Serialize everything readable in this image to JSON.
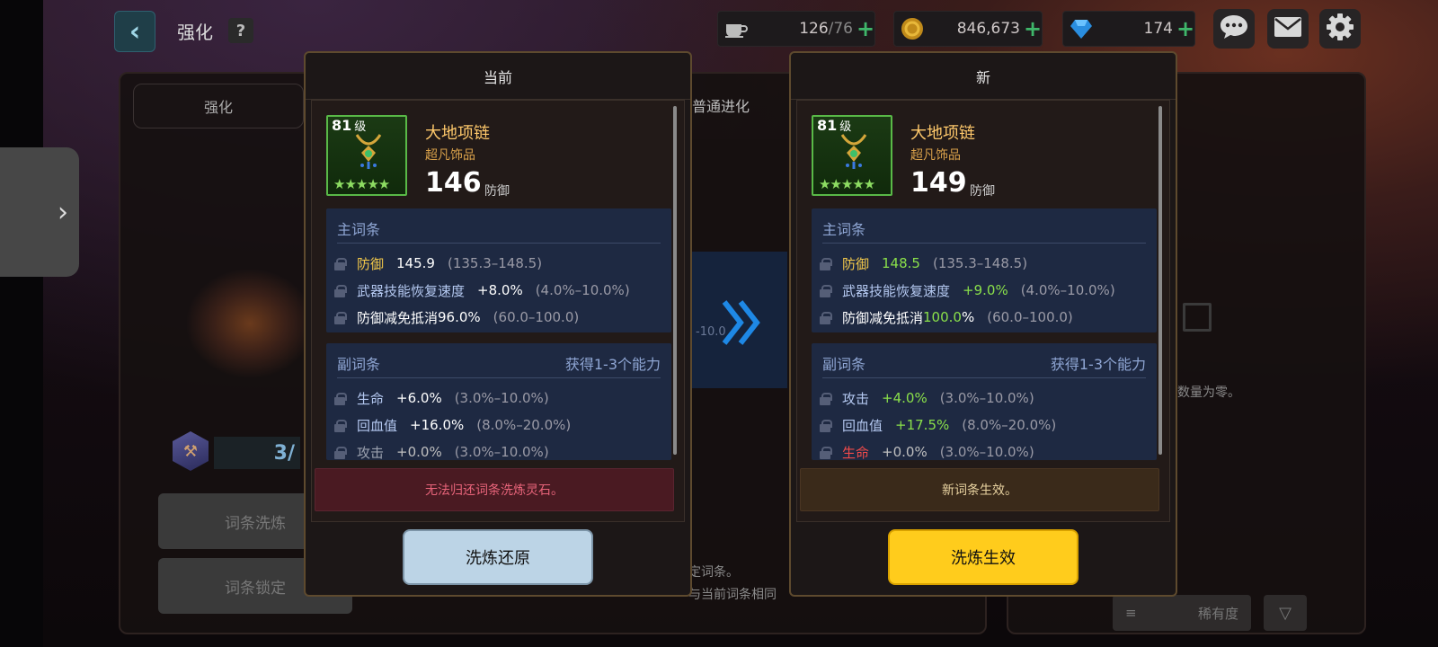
{
  "header": {
    "back_icon": "chevron-left-icon",
    "title": "强化",
    "help": "?"
  },
  "resources": [
    {
      "icon": "coffee-icon",
      "value": "126",
      "max": "/76",
      "plus": "+"
    },
    {
      "icon": "gold-coin-icon",
      "value": "846,673",
      "plus": "+"
    },
    {
      "icon": "gem-icon",
      "value": "174",
      "plus": "+"
    }
  ],
  "background": {
    "tab_enhance": "强化",
    "tab_evolve": "普通进化",
    "progress": "3/",
    "btn_reroll": "词条洗炼",
    "btn_lock": "词条锁定",
    "ghost_range": "-10.0",
    "empty_msg": "数量为零。",
    "hint1": "定词条。",
    "hint2": "与当前词条相同",
    "sort_label": "稀有度"
  },
  "current": {
    "title": "当前",
    "level": "81",
    "level_unit": "级",
    "stars": "★★★★★",
    "name": "大地项链",
    "subtitle": "超凡饰品",
    "power": "146",
    "power_label": "防御",
    "main_header": "主词条",
    "main": [
      {
        "name": "防御",
        "value": "145.9",
        "range": "(135.3–148.5)"
      },
      {
        "name": "武器技能恢复速度",
        "value": "+8.0%",
        "range": "(4.0%–10.0%)"
      },
      {
        "name": "防御减免抵消",
        "value": "96.0%",
        "range": "(60.0–100.0)"
      }
    ],
    "sub_header": "副词条",
    "sub_right": "获得1-3个能力",
    "sub": [
      {
        "name": "生命",
        "value": "+6.0%",
        "range": "(3.0%–10.0%)"
      },
      {
        "name": "回血值",
        "value": "+16.0%",
        "range": "(8.0%–20.0%)"
      },
      {
        "name": "攻击",
        "value": "+0.0%",
        "range": "(3.0%–10.0%)"
      }
    ],
    "notice": "无法归还词条洗炼灵石。",
    "button": "洗炼还原"
  },
  "new": {
    "title": "新",
    "level": "81",
    "level_unit": "级",
    "stars": "★★★★★",
    "name": "大地项链",
    "subtitle": "超凡饰品",
    "power": "149",
    "power_label": "防御",
    "main_header": "主词条",
    "main": [
      {
        "name": "防御",
        "value": "148.5",
        "range": "(135.3–148.5)"
      },
      {
        "name": "武器技能恢复速度",
        "value": "+9.0%",
        "range": "(4.0%–10.0%)"
      },
      {
        "name": "防御减免抵消",
        "value": "100.0",
        "suffix": "%",
        "range": "(60.0–100.0)"
      }
    ],
    "sub_header": "副词条",
    "sub_right": "获得1-3个能力",
    "sub": [
      {
        "name": "攻击",
        "value": "+4.0%",
        "range": "(3.0%–10.0%)"
      },
      {
        "name": "回血值",
        "value": "+17.5%",
        "range": "(8.0%–20.0%)"
      },
      {
        "name": "生命",
        "value": "+0.0%",
        "range": "(3.0%–10.0%)"
      }
    ],
    "notice": "新词条生效。",
    "button": "洗炼生效"
  },
  "colors": {
    "accent_yellow": "#ffcc1c",
    "stat_green": "#8ae04a",
    "stat_gold": "#f2c84a",
    "item_frame": "#59b947"
  }
}
